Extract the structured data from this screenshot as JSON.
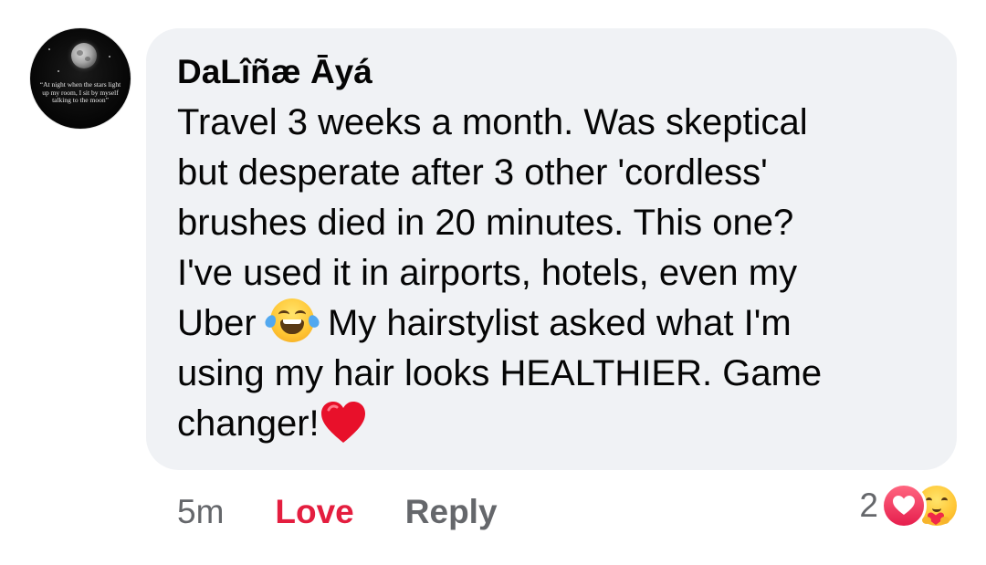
{
  "comment": {
    "author": "DaLîñæ Āyá",
    "avatar_caption": "“At night when the stars light\nup my room, I sit by myself\ntalking to the moon”",
    "text_part1": "Travel 3 weeks a month. Was skeptical\nbut desperate after 3 other 'cordless'\nbrushes died in 20 minutes. This one?\nI've used it in airports, hotels, even my\nUber",
    "text_part2": " My hairstylist asked what I'm\nusing  my hair looks HEALTHIER. Game\nchanger!",
    "inline_emojis": [
      "face-with-tears-of-joy-icon",
      "red-heart-icon"
    ],
    "time": "5m",
    "love_label": "Love",
    "reply_label": "Reply",
    "reaction_count": "2",
    "reaction_icons": [
      "love-reaction-icon",
      "care-reaction-icon"
    ]
  },
  "colors": {
    "bubble_bg": "#f0f2f5",
    "text": "#050505",
    "muted": "#65676b",
    "love_red": "#e41e3f"
  }
}
